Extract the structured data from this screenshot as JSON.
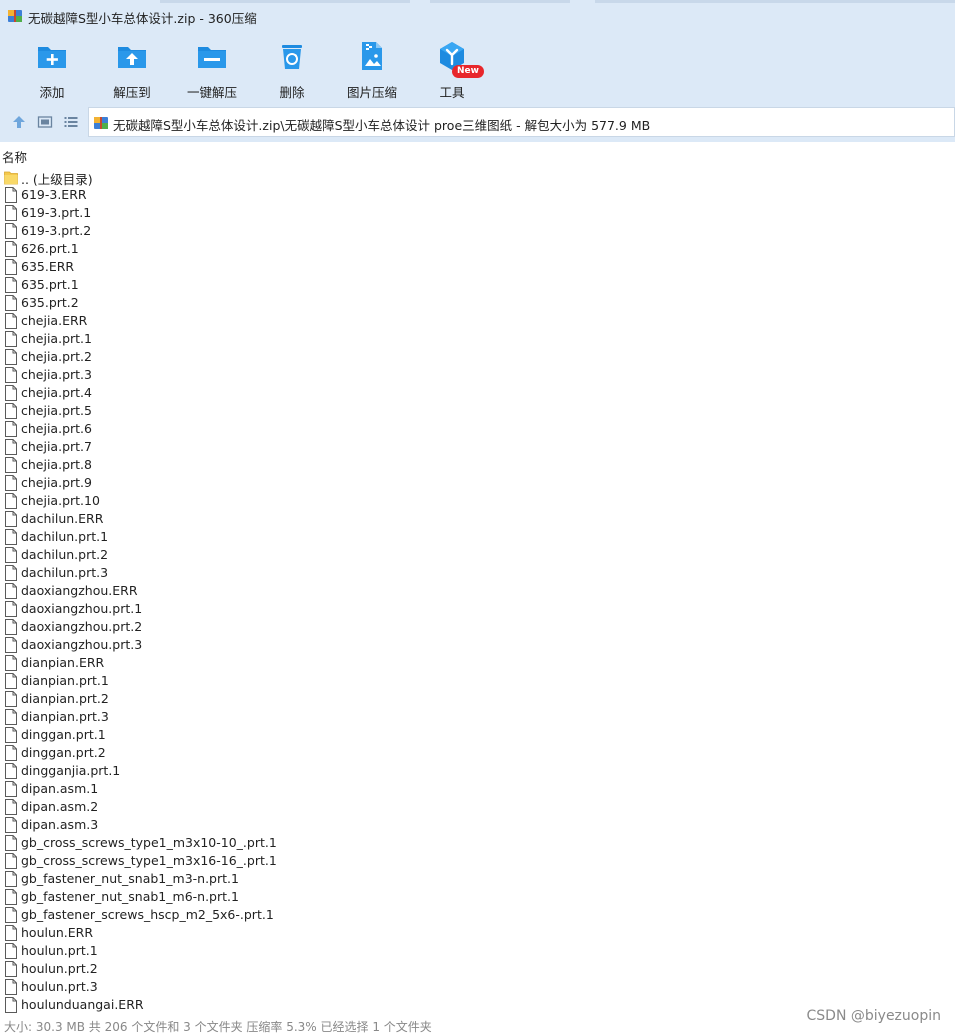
{
  "window": {
    "title": "无碳越障S型小车总体设计.zip - 360压缩"
  },
  "toolbar": {
    "items": [
      {
        "label": "添加",
        "icon": "add-folder-icon"
      },
      {
        "label": "解压到",
        "icon": "extract-to-icon"
      },
      {
        "label": "一键解压",
        "icon": "one-click-extract-icon"
      },
      {
        "label": "删除",
        "icon": "recycle-bin-icon"
      },
      {
        "label": "图片压缩",
        "icon": "image-compress-icon"
      },
      {
        "label": "工具",
        "icon": "tools-icon"
      }
    ],
    "new_badge": "New"
  },
  "address": {
    "path": "无碳越障S型小车总体设计.zip\\无碳越障S型小车总体设计 proe三维图纸 - 解包大小为 577.9 MB"
  },
  "columns": {
    "name": "名称"
  },
  "files": [
    {
      "name": ".. (上级目录)",
      "type": "folder"
    },
    {
      "name": "619-3.ERR",
      "type": "file"
    },
    {
      "name": "619-3.prt.1",
      "type": "file"
    },
    {
      "name": "619-3.prt.2",
      "type": "file"
    },
    {
      "name": "626.prt.1",
      "type": "file"
    },
    {
      "name": "635.ERR",
      "type": "file"
    },
    {
      "name": "635.prt.1",
      "type": "file"
    },
    {
      "name": "635.prt.2",
      "type": "file"
    },
    {
      "name": "chejia.ERR",
      "type": "file"
    },
    {
      "name": "chejia.prt.1",
      "type": "file"
    },
    {
      "name": "chejia.prt.2",
      "type": "file"
    },
    {
      "name": "chejia.prt.3",
      "type": "file"
    },
    {
      "name": "chejia.prt.4",
      "type": "file"
    },
    {
      "name": "chejia.prt.5",
      "type": "file"
    },
    {
      "name": "chejia.prt.6",
      "type": "file"
    },
    {
      "name": "chejia.prt.7",
      "type": "file"
    },
    {
      "name": "chejia.prt.8",
      "type": "file"
    },
    {
      "name": "chejia.prt.9",
      "type": "file"
    },
    {
      "name": "chejia.prt.10",
      "type": "file"
    },
    {
      "name": "dachilun.ERR",
      "type": "file"
    },
    {
      "name": "dachilun.prt.1",
      "type": "file"
    },
    {
      "name": "dachilun.prt.2",
      "type": "file"
    },
    {
      "name": "dachilun.prt.3",
      "type": "file"
    },
    {
      "name": "daoxiangzhou.ERR",
      "type": "file"
    },
    {
      "name": "daoxiangzhou.prt.1",
      "type": "file"
    },
    {
      "name": "daoxiangzhou.prt.2",
      "type": "file"
    },
    {
      "name": "daoxiangzhou.prt.3",
      "type": "file"
    },
    {
      "name": "dianpian.ERR",
      "type": "file"
    },
    {
      "name": "dianpian.prt.1",
      "type": "file"
    },
    {
      "name": "dianpian.prt.2",
      "type": "file"
    },
    {
      "name": "dianpian.prt.3",
      "type": "file"
    },
    {
      "name": "dinggan.prt.1",
      "type": "file"
    },
    {
      "name": "dinggan.prt.2",
      "type": "file"
    },
    {
      "name": "dingganjia.prt.1",
      "type": "file"
    },
    {
      "name": "dipan.asm.1",
      "type": "file"
    },
    {
      "name": "dipan.asm.2",
      "type": "file"
    },
    {
      "name": "dipan.asm.3",
      "type": "file"
    },
    {
      "name": "gb_cross_screws_type1_m3x10-10_.prt.1",
      "type": "file"
    },
    {
      "name": "gb_cross_screws_type1_m3x16-16_.prt.1",
      "type": "file"
    },
    {
      "name": "gb_fastener_nut_snab1_m3-n.prt.1",
      "type": "file"
    },
    {
      "name": "gb_fastener_nut_snab1_m6-n.prt.1",
      "type": "file"
    },
    {
      "name": "gb_fastener_screws_hscp_m2_5x6-.prt.1",
      "type": "file"
    },
    {
      "name": "houlun.ERR",
      "type": "file"
    },
    {
      "name": "houlun.prt.1",
      "type": "file"
    },
    {
      "name": "houlun.prt.2",
      "type": "file"
    },
    {
      "name": "houlun.prt.3",
      "type": "file"
    },
    {
      "name": "houlunduangai.ERR",
      "type": "file"
    }
  ],
  "status": {
    "text": "大小: 30.3 MB 共 206 个文件和 3 个文件夹 压缩率 5.3% 已经选择 1 个文件夹"
  },
  "watermark": "CSDN @biyezuopin",
  "colors": {
    "chrome": "#dce9f7",
    "accent": "#1e8be0",
    "badge": "#e8262b",
    "folder": "#f5c94d"
  }
}
